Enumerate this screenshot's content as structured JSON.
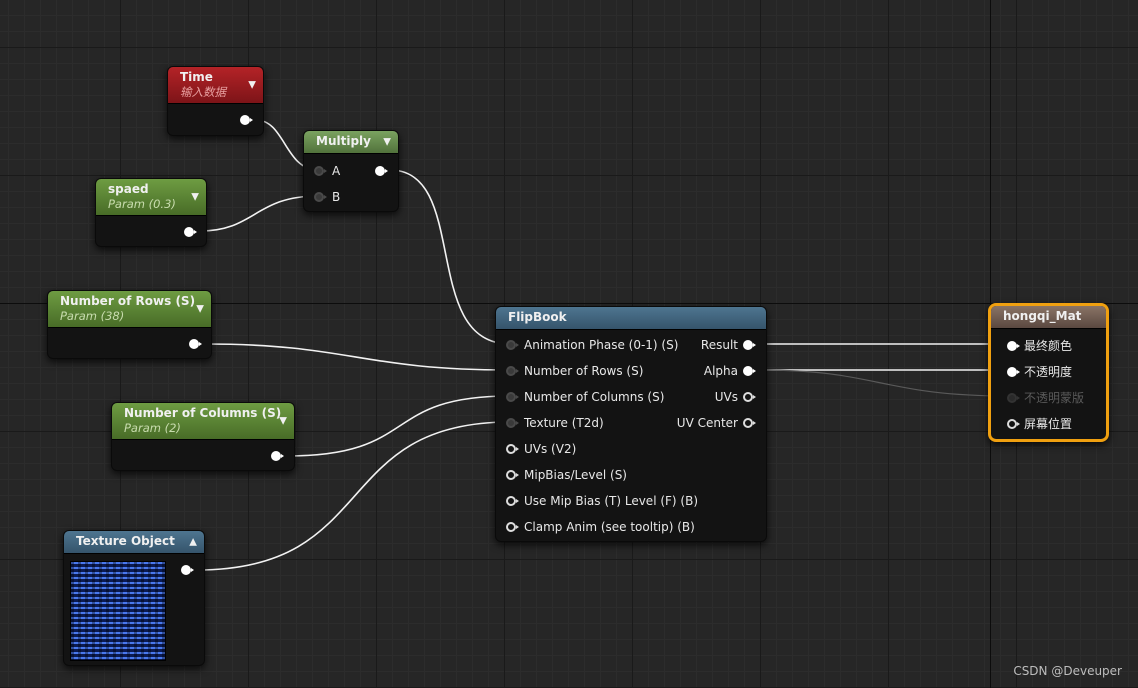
{
  "nodes": {
    "time": {
      "title": "Time",
      "subtitle": "输入数据"
    },
    "multiply": {
      "title": "Multiply",
      "pins": [
        "A",
        "B"
      ]
    },
    "spaed": {
      "title": "spaed",
      "subtitle": "Param (0.3)"
    },
    "rows": {
      "title": "Number of Rows (S)",
      "subtitle": "Param (38)"
    },
    "columns": {
      "title": "Number of Columns (S)",
      "subtitle": "Param (2)"
    },
    "texture": {
      "title": "Texture Object"
    },
    "flipbook": {
      "title": "FlipBook",
      "inputs": [
        "Animation  Phase (0-1) (S)",
        "Number of Rows (S)",
        "Number of Columns (S)",
        "Texture (T2d)",
        "UVs (V2)",
        "MipBias/Level (S)",
        "Use Mip Bias (T) Level (F) (B)",
        "Clamp Anim (see tooltip) (B)"
      ],
      "outputs": [
        "Result",
        "Alpha",
        "UVs",
        "UV Center"
      ]
    },
    "material": {
      "title": "hongqi_Mat",
      "inputs": [
        "最终颜色",
        "不透明度",
        "不透明蒙版",
        "屏幕位置"
      ]
    }
  },
  "watermark": "CSDN @Deveuper",
  "icons": {
    "collapse": "chevron-down-icon",
    "expand": "chevron-up-icon"
  },
  "colors": {
    "selection": "#f0a010",
    "wire": "#f2f2f2",
    "grid_bg": "#262626"
  }
}
